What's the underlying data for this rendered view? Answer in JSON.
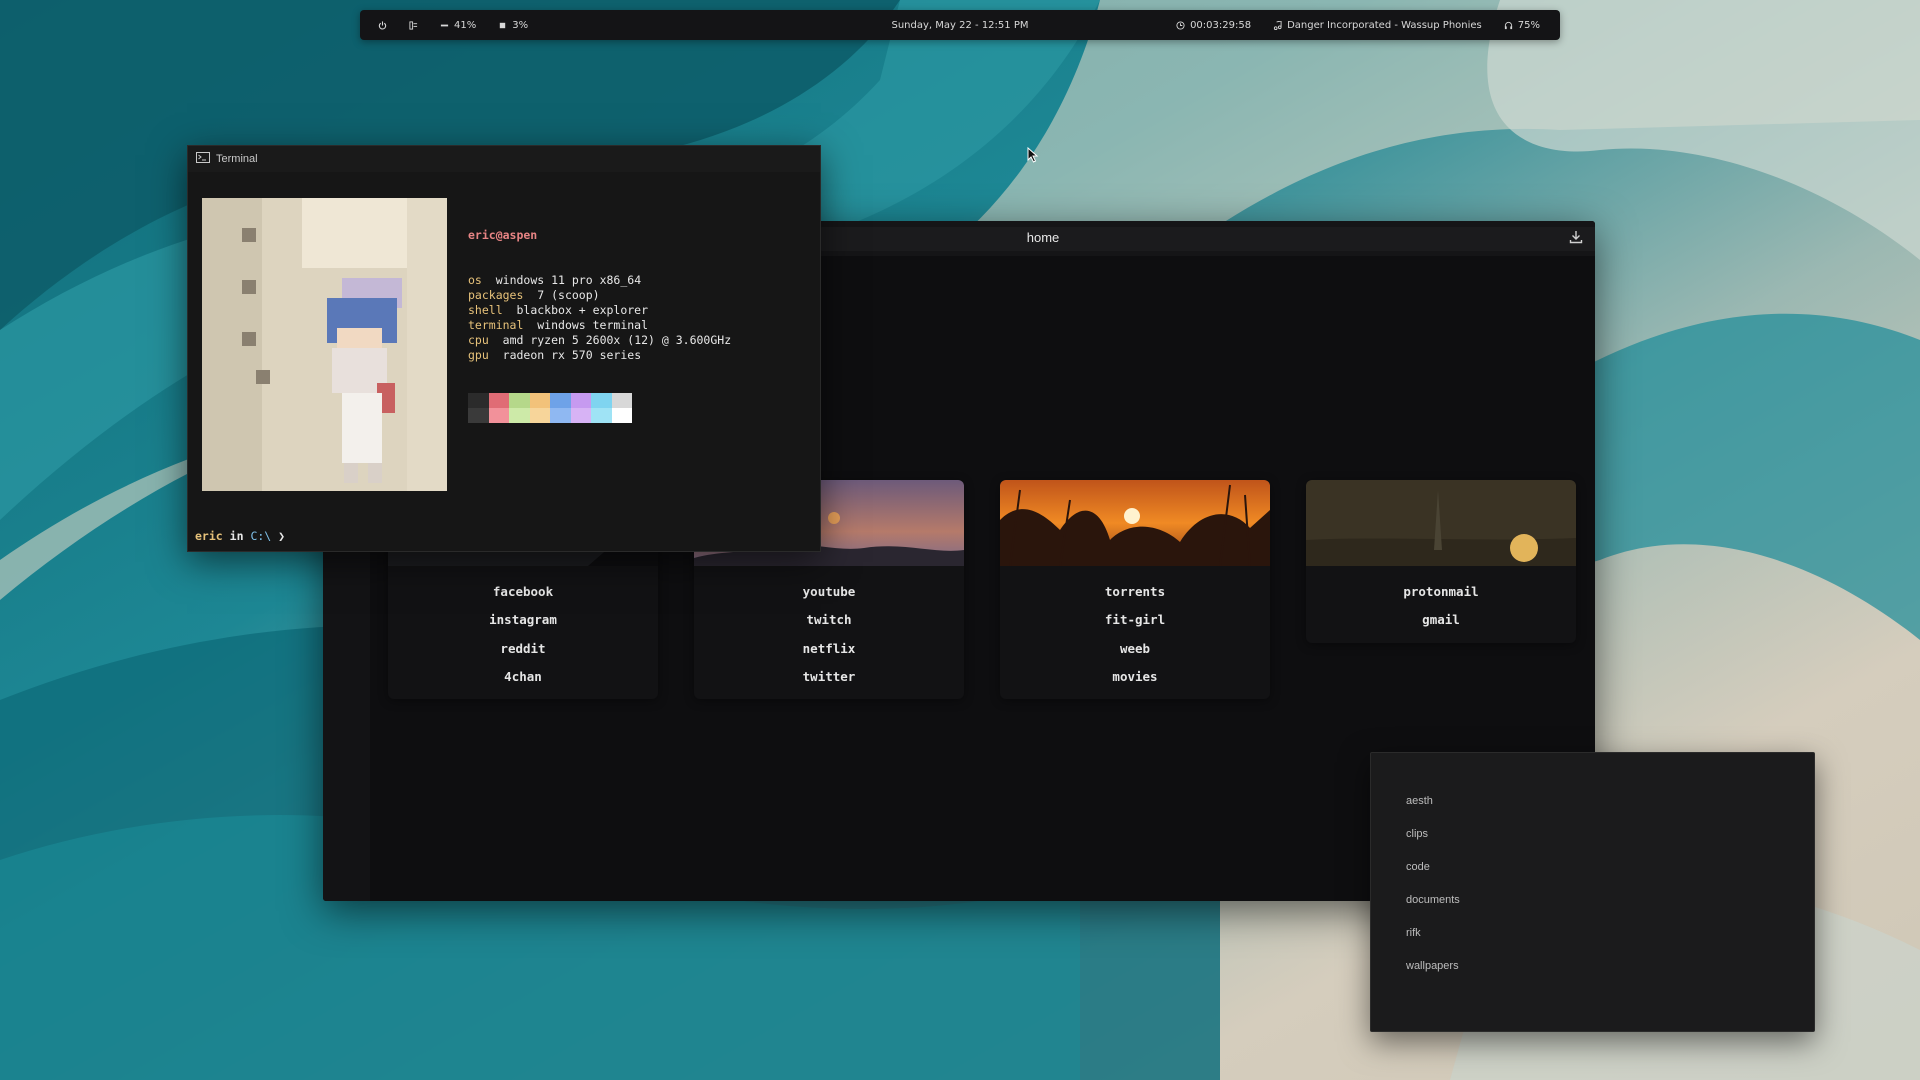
{
  "topbar": {
    "power_icon": "power-icon",
    "layout_icon": "layout-icon",
    "cpu_value": "41%",
    "ram_value": "3%",
    "datetime": "Sunday, May 22 - 12:51 PM",
    "uptime": "00:03:29:58",
    "now_playing": "Danger Incorporated - Wassup Phonies",
    "volume": "75%"
  },
  "browser": {
    "url": "home",
    "cards": [
      {
        "links": [
          "facebook",
          "instagram",
          "reddit",
          "4chan"
        ]
      },
      {
        "links": [
          "youtube",
          "twitch",
          "netflix",
          "twitter"
        ]
      },
      {
        "links": [
          "torrents",
          "fit-girl",
          "weeb",
          "movies"
        ]
      },
      {
        "links": [
          "protonmail",
          "gmail"
        ]
      }
    ]
  },
  "terminal": {
    "title": "Terminal",
    "user_host": "eric@aspen",
    "info": [
      {
        "key": "os",
        "value": "windows 11 pro x86_64"
      },
      {
        "key": "packages",
        "value": "7 (scoop)"
      },
      {
        "key": "shell",
        "value": "blackbox + explorer"
      },
      {
        "key": "terminal",
        "value": "windows terminal"
      },
      {
        "key": "cpu",
        "value": "amd ryzen 5 2600x (12) @ 3.600GHz"
      },
      {
        "key": "gpu",
        "value": "radeon rx 570 series"
      }
    ],
    "palette": [
      "#2b2b2b",
      "#e06c75",
      "#b5d88a",
      "#f2c27a",
      "#6ea2e8",
      "#c69af0",
      "#7fd4f0",
      "#d8d8d8",
      "#3a3a3a",
      "#f2919a",
      "#cdeaa8",
      "#f7d59a",
      "#8fb8f2",
      "#d7b3f5",
      "#9fe3f5",
      "#ffffff"
    ],
    "prompt_user": "eric",
    "prompt_in": "in",
    "prompt_path": "C:\\",
    "prompt_symbol": "❯"
  },
  "folders": {
    "items": [
      "aesth",
      "clips",
      "code",
      "documents",
      "rifk",
      "wallpapers"
    ]
  }
}
